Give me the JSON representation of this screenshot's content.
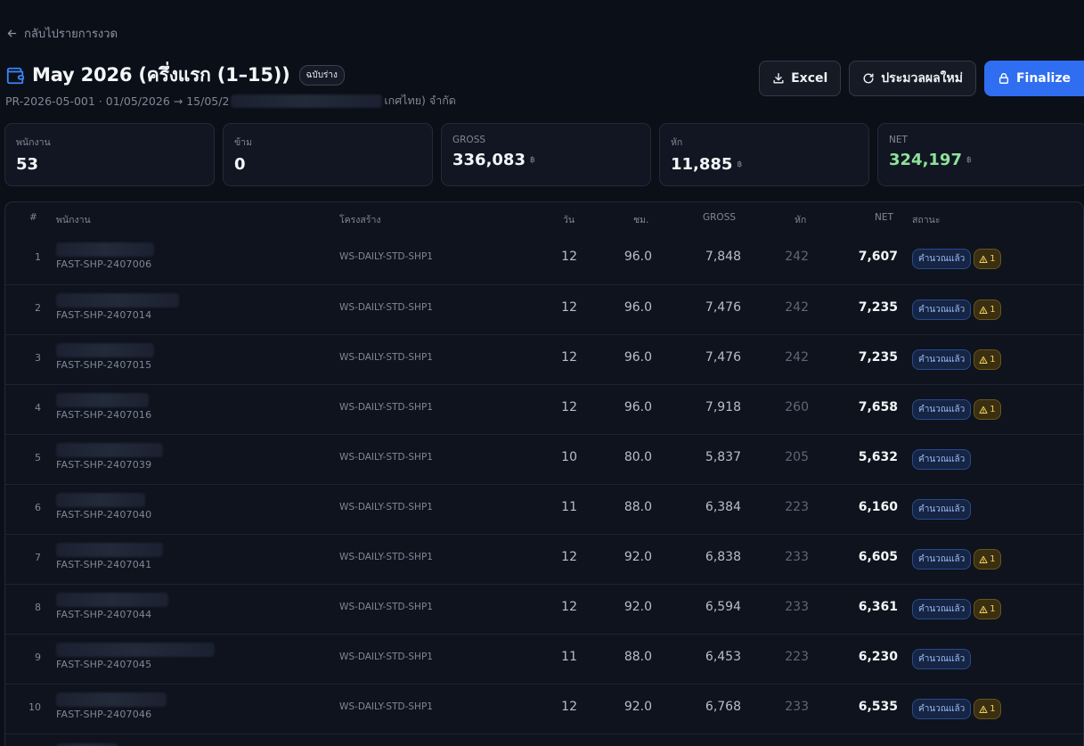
{
  "back_link": {
    "label": "กลับไปรายการงวด"
  },
  "header": {
    "title": "May 2026 (ครึ่งแรก (1–15))",
    "badge": "ฉบับร่าง",
    "subtitle_prefix": "PR-2026-05-001 · 01/05/2026 → 15/05/2",
    "subtitle_suffix": "เกศไทย) จำกัด"
  },
  "actions": {
    "excel": "Excel",
    "recalculate": "ประมวลผลใหม่",
    "finalize": "Finalize"
  },
  "stats": [
    {
      "label": "พนักงาน",
      "value": "53",
      "currency": ""
    },
    {
      "label": "ข้าม",
      "value": "0",
      "currency": ""
    },
    {
      "label": "GROSS",
      "value": "336,083",
      "currency": "฿"
    },
    {
      "label": "หัก",
      "value": "11,885",
      "currency": "฿"
    },
    {
      "label": "NET",
      "value": "324,197",
      "currency": "฿"
    }
  ],
  "table": {
    "headers": {
      "num": "#",
      "employee": "พนักงาน",
      "structure": "โครงสร้าง",
      "days": "วัน",
      "hours": "ชม.",
      "gross": "GROSS",
      "deduction": "หัก",
      "net": "NET",
      "status": "สถานะ"
    },
    "status_label": "คำนวณแล้ว",
    "rows": [
      {
        "num": "1",
        "code": "FAST-SHP-2407006",
        "structure": "WS-DAILY-STD-SHP1",
        "days": "12",
        "hours": "96.0",
        "gross": "7,848",
        "deduction": "242",
        "net": "7,607",
        "warning": "1"
      },
      {
        "num": "2",
        "code": "FAST-SHP-2407014",
        "structure": "WS-DAILY-STD-SHP1",
        "days": "12",
        "hours": "96.0",
        "gross": "7,476",
        "deduction": "242",
        "net": "7,235",
        "warning": "1"
      },
      {
        "num": "3",
        "code": "FAST-SHP-2407015",
        "structure": "WS-DAILY-STD-SHP1",
        "days": "12",
        "hours": "96.0",
        "gross": "7,476",
        "deduction": "242",
        "net": "7,235",
        "warning": "1"
      },
      {
        "num": "4",
        "code": "FAST-SHP-2407016",
        "structure": "WS-DAILY-STD-SHP1",
        "days": "12",
        "hours": "96.0",
        "gross": "7,918",
        "deduction": "260",
        "net": "7,658",
        "warning": "1"
      },
      {
        "num": "5",
        "code": "FAST-SHP-2407039",
        "structure": "WS-DAILY-STD-SHP1",
        "days": "10",
        "hours": "80.0",
        "gross": "5,837",
        "deduction": "205",
        "net": "5,632",
        "warning": ""
      },
      {
        "num": "6",
        "code": "FAST-SHP-2407040",
        "structure": "WS-DAILY-STD-SHP1",
        "days": "11",
        "hours": "88.0",
        "gross": "6,384",
        "deduction": "223",
        "net": "6,160",
        "warning": ""
      },
      {
        "num": "7",
        "code": "FAST-SHP-2407041",
        "structure": "WS-DAILY-STD-SHP1",
        "days": "12",
        "hours": "92.0",
        "gross": "6,838",
        "deduction": "233",
        "net": "6,605",
        "warning": "1"
      },
      {
        "num": "8",
        "code": "FAST-SHP-2407044",
        "structure": "WS-DAILY-STD-SHP1",
        "days": "12",
        "hours": "92.0",
        "gross": "6,594",
        "deduction": "233",
        "net": "6,361",
        "warning": "1"
      },
      {
        "num": "9",
        "code": "FAST-SHP-2407045",
        "structure": "WS-DAILY-STD-SHP1",
        "days": "11",
        "hours": "88.0",
        "gross": "6,453",
        "deduction": "223",
        "net": "6,230",
        "warning": ""
      },
      {
        "num": "10",
        "code": "FAST-SHP-2407046",
        "structure": "WS-DAILY-STD-SHP1",
        "days": "12",
        "hours": "92.0",
        "gross": "6,768",
        "deduction": "233",
        "net": "6,535",
        "warning": "1"
      }
    ]
  },
  "colors": {
    "background": "#0b0f17",
    "primary": "#2f6ef0",
    "net_green": "#8ee29a",
    "status_blue": "#9bbcf6",
    "warning_yellow": "#f4cf5a"
  }
}
